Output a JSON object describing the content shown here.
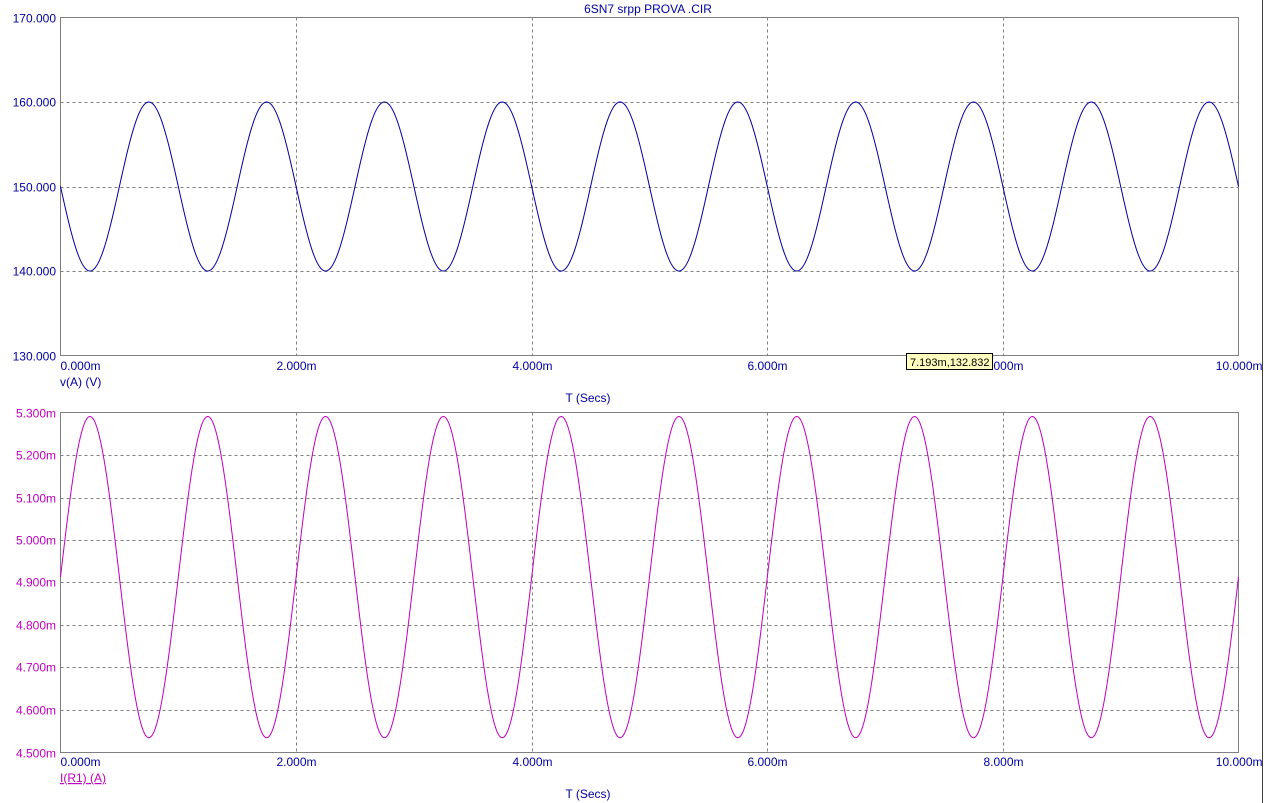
{
  "chart_data": [
    {
      "type": "line",
      "title": "6SN7 srpp PROVA .CIR",
      "xlabel": "T (Secs)",
      "ylabel": "v(A) (V)",
      "xlim": [
        0,
        10
      ],
      "ylim": [
        130,
        170
      ],
      "x_unit": "ms",
      "x_ticks": [
        "0.000m",
        "2.000m",
        "4.000m",
        "6.000m",
        "8.000m",
        "10.000m"
      ],
      "y_ticks": [
        "170.000",
        "160.000",
        "150.000",
        "140.000",
        "130.000"
      ],
      "grid": true,
      "color": "#0000a0",
      "series": [
        {
          "name": "v(A) (V)",
          "waveform": "sine",
          "offset": 150,
          "amplitude": -10,
          "period": 1.0,
          "x_range": [
            0,
            10
          ],
          "values_sampled": {
            "x": [
              0,
              0.25,
              0.5,
              0.75,
              1.0,
              5.0,
              10.0
            ],
            "y": [
              150,
              140,
              150,
              160,
              150,
              150,
              150
            ]
          }
        }
      ],
      "cursor_tooltip": "7.193m,132.832"
    },
    {
      "type": "line",
      "title": "",
      "xlabel": "T (Secs)",
      "ylabel": "I(R1) (A)",
      "xlim": [
        0,
        10
      ],
      "ylim": [
        4.5,
        5.3
      ],
      "x_unit": "ms",
      "x_ticks": [
        "0.000m",
        "2.000m",
        "4.000m",
        "6.000m",
        "8.000m",
        "10.000m"
      ],
      "y_ticks": [
        "5.300m",
        "5.200m",
        "5.100m",
        "5.000m",
        "4.900m",
        "4.800m",
        "4.700m",
        "4.600m",
        "4.500m"
      ],
      "grid": true,
      "color": "#c000c0",
      "series": [
        {
          "name": "I(R1) (A)",
          "waveform": "sine",
          "offset": 4.9127,
          "amplitude": 0.378,
          "period": 1.0,
          "x_range": [
            0,
            10
          ],
          "values_sampled": {
            "x": [
              0,
              0.25,
              0.5,
              0.75,
              1.0
            ],
            "y": [
              4.9127,
              5.2907,
              4.9127,
              4.5347,
              4.9127
            ]
          }
        }
      ]
    }
  ]
}
